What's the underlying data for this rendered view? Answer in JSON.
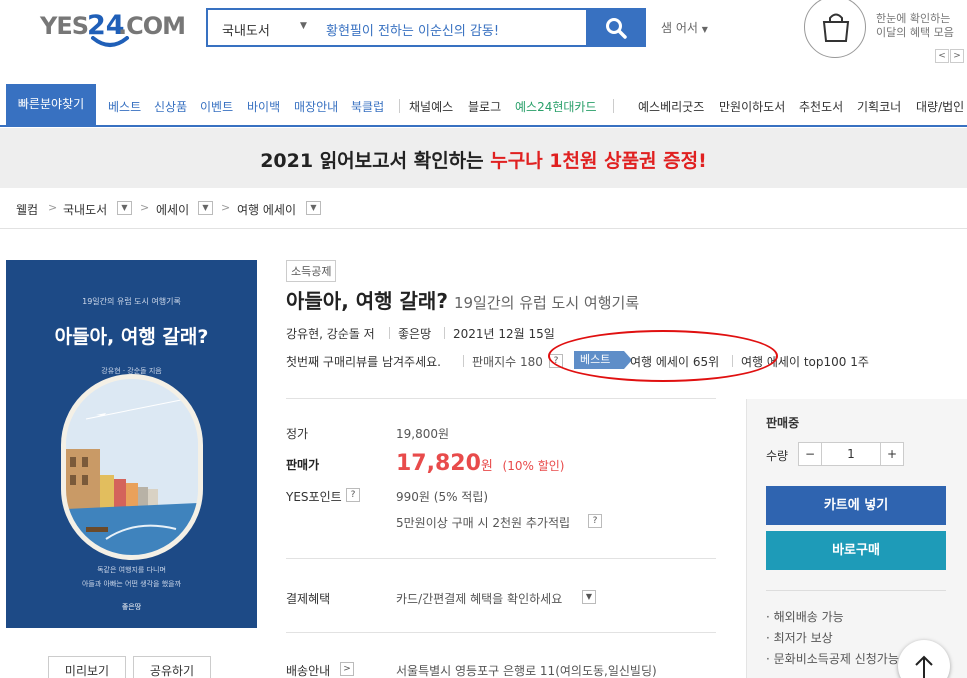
{
  "header": {
    "logo_text_left": "YES",
    "logo_text_num": "24",
    "logo_text_right": ".COM",
    "search_category": "국내도서",
    "search_value": "황현필이 전하는 이순신의 감동!",
    "sam_menu": "샘 어서",
    "promo_line1": "한눈에 확인하는",
    "promo_line2": "이달의 혜택 모음",
    "prev_arrow": "<",
    "next_arrow": ">"
  },
  "nav": {
    "quick_label": "빠른분야찾기",
    "items": [
      "베스트",
      "신상품",
      "이벤트",
      "바이백",
      "매장안내",
      "북클럽",
      "채널예스",
      "블로그",
      "예스24현대카드"
    ],
    "right_items": [
      "예스베리굿즈",
      "만원이하도서",
      "추천도서",
      "기획코너",
      "대량/법인"
    ]
  },
  "banner": {
    "text_black": "2021 읽어보고서 확인하는 ",
    "text_red": "누구나 1천원 상품권 증정!"
  },
  "breadcrumb": {
    "items": [
      "웰컴",
      "국내도서",
      "에세이",
      "여행 에세이"
    ]
  },
  "cover": {
    "top_text": "19일간의 유럽 도시 여행기록",
    "title": "아들아, 여행 갈래?",
    "authors": "강유현 · 강순돌 지음",
    "bottom_line1": "독같은 여행지를 다니며",
    "bottom_line2": "아들과 아빠는 어떤 생각을 했을까",
    "publisher": "좋은땅"
  },
  "buttons": {
    "preview": "미리보기",
    "share": "공유하기"
  },
  "product": {
    "tag": "소득공제",
    "title": "아들아, 여행 갈래?",
    "subtitle": "19일간의 유럽 도시 여행기록",
    "authors": "강유현, 강순돌 저",
    "publisher": "좋은땅",
    "date": "2021년 12월 15일",
    "review": "첫번째 구매리뷰를 남겨주세요.",
    "sales_index": "판매지수 180",
    "best_badge": "베스트",
    "rank1": "여행 에세이 65위",
    "rank2": "여행 에세이 top100 1주",
    "q_mark": "?"
  },
  "pricing": {
    "list_label": "정가",
    "list_value": "19,800원",
    "sale_label": "판매가",
    "sale_value": "17,820",
    "sale_unit": "원",
    "sale_discount": "(10% 할인)",
    "points_label": "YES포인트",
    "points_value": "990원 (5% 적립)",
    "extra_points": "5만원이상 구매 시 2천원 추가적립",
    "payment_label": "결제혜택",
    "payment_value": "카드/간편결제 혜택을 확인하세요",
    "shipping_label": "배송안내",
    "shipping_value": "서울특별시 영등포구 은행로 11(여의도동,일신빌딩)"
  },
  "panel": {
    "status": "판매중",
    "qty_label": "수량",
    "minus": "−",
    "qty": "1",
    "plus": "+",
    "cart": "카트에 넣기",
    "buy": "바로구매",
    "notes": [
      "· 해외배송 가능",
      "· 최저가 보상",
      "· 문화비소득공제 신청가능"
    ]
  },
  "colors": {
    "brand_blue": "#3871c1",
    "sale_red": "#e84b4b",
    "cart_blue": "#2f64b0",
    "buy_teal": "#1e9bb8"
  }
}
